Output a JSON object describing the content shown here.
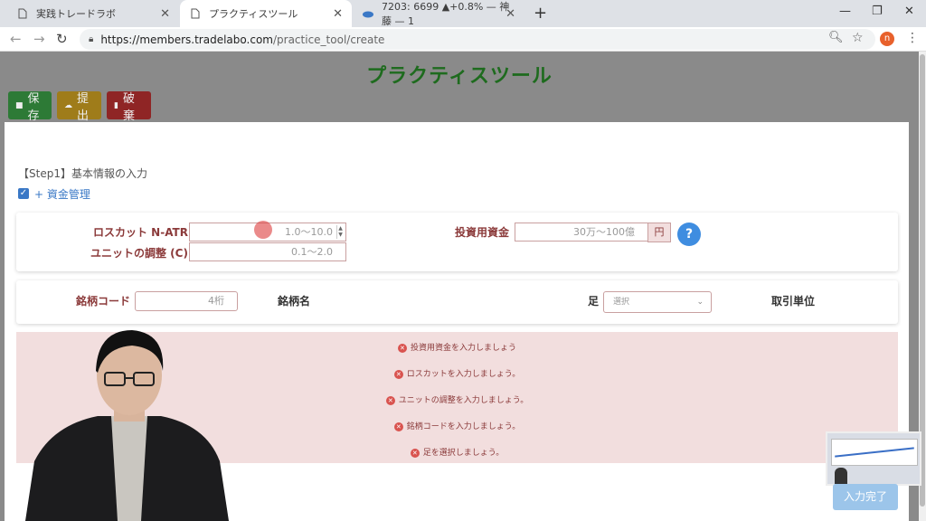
{
  "browser": {
    "tabs": [
      {
        "title": "実践トレードラボ",
        "icon": "page-icon"
      },
      {
        "title": "プラクティスツール",
        "icon": "page-icon",
        "active": true
      },
      {
        "title": "7203: 6699 ▲+0.8% — 神藤 — 1",
        "icon": "cloud-icon"
      }
    ],
    "url_host": "https://members.tradelabo.com",
    "url_path": "/practice_tool/create",
    "avatar_letter": "n"
  },
  "page": {
    "title": "プラクティスツール",
    "toolbar": {
      "save_label": "保存",
      "submit_label": "提出",
      "discard_label": "破棄"
    },
    "step_title": "【Step1】基本情報の入力",
    "money_toggle_label": "+ 資金管理",
    "money_toggle_checked": true,
    "losscut": {
      "label": "ロスカット N-ATR",
      "placeholder": "1.0～10.0"
    },
    "unit_adjust": {
      "label": "ユニットの調整 (C)",
      "placeholder": "0.1～2.0"
    },
    "capital": {
      "label": "投資用資金",
      "placeholder": "30万～100億",
      "unit": "円",
      "help": "?"
    },
    "ticker": {
      "label": "銘柄コード",
      "placeholder": "4桁"
    },
    "ticker_name_label": "銘柄名",
    "bar_label": "足",
    "bar_select_placeholder": "選択",
    "trade_unit_label": "取引単位",
    "errors": [
      "投資用資金を入力しましょう",
      "ロスカットを入力しましょう。",
      "ユニットの調整を入力しましょう。",
      "銘柄コードを入力しましょう。",
      "足を選択しましょう。"
    ],
    "done_label": "入力完了"
  },
  "colors": {
    "title_green": "#1e6b1e",
    "save": "#2d7a36",
    "submit": "#9f7c1a",
    "discard": "#8f2525",
    "error_bg": "#f2dede",
    "error_text": "#8b3a3a",
    "link_blue": "#3a78c6"
  }
}
